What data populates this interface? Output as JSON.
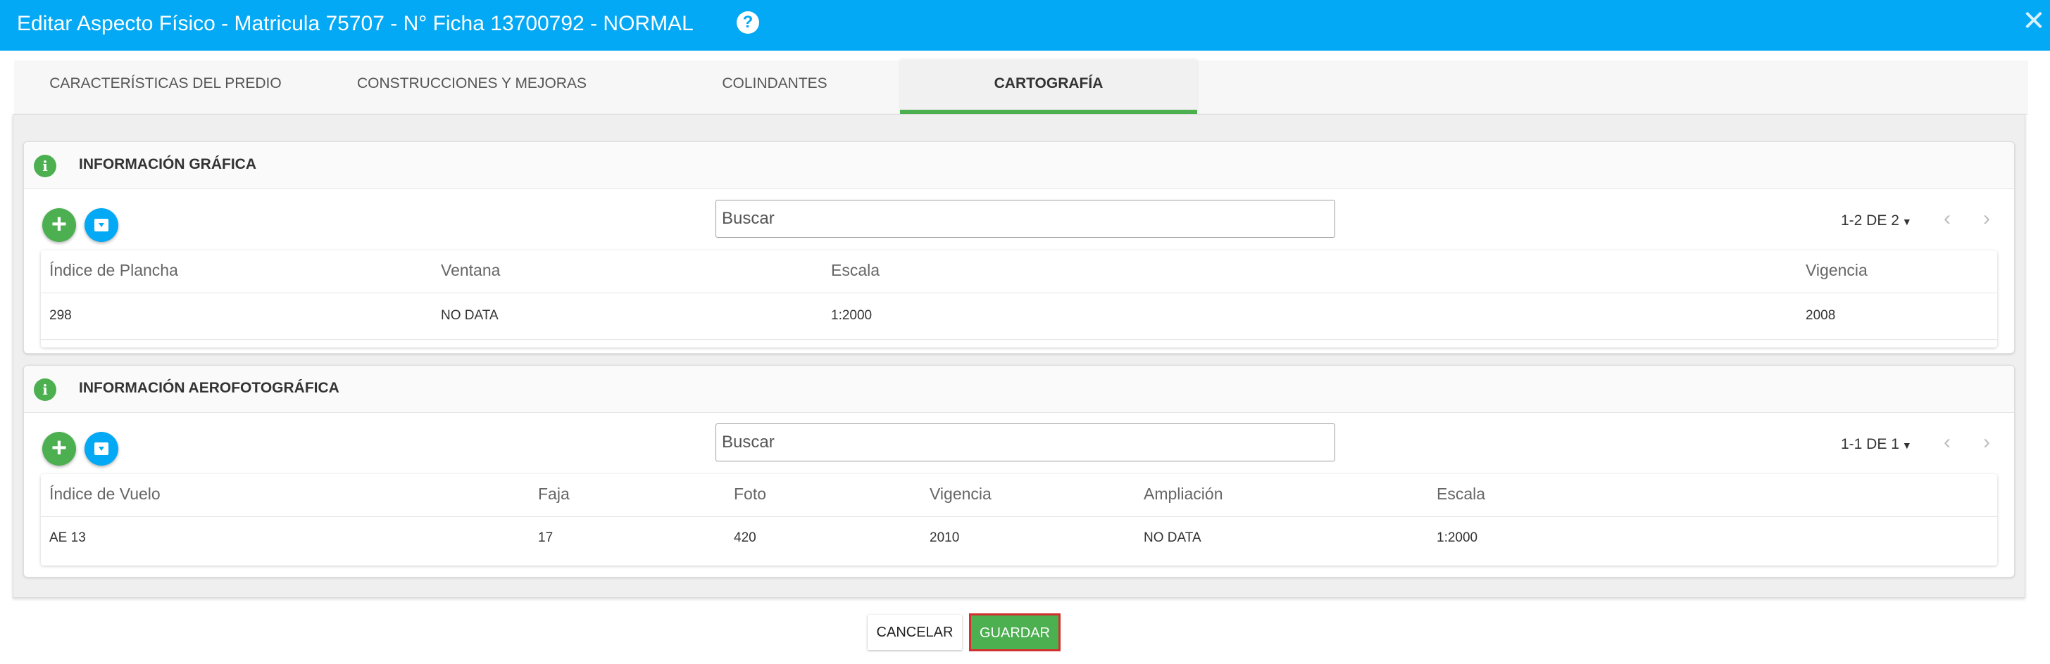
{
  "header": {
    "title": "Editar Aspecto Físico - Matricula 75707 - N° Ficha 13700792 - NORMAL",
    "help_icon": "?",
    "close_icon": "✕"
  },
  "tabs": [
    {
      "label": "CARACTERÍSTICAS DEL PREDIO",
      "active": false
    },
    {
      "label": "CONSTRUCCIONES Y MEJORAS",
      "active": false
    },
    {
      "label": "COLINDANTES",
      "active": false
    },
    {
      "label": "CARTOGRAFÍA",
      "active": true
    }
  ],
  "grafica": {
    "title": "INFORMACIÓN GRÁFICA",
    "add_icon": "+",
    "search_placeholder": "Buscar",
    "pager": "1-2 DE 2",
    "columns": [
      "Índice de Plancha",
      "Ventana",
      "Escala",
      "Vigencia"
    ],
    "rows": [
      [
        "298",
        "NO DATA",
        "1:2000",
        "2008"
      ]
    ]
  },
  "aerofoto": {
    "title": "INFORMACIÓN AEROFOTOGRÁFICA",
    "add_icon": "+",
    "search_placeholder": "Buscar",
    "pager": "1-1 DE 1",
    "columns": [
      "Índice de Vuelo",
      "Faja",
      "Foto",
      "Vigencia",
      "Ampliación",
      "Escala"
    ],
    "rows": [
      [
        "AE 13",
        "17",
        "420",
        "2010",
        "NO DATA",
        "1:2000"
      ]
    ]
  },
  "footer": {
    "cancel_label": "CANCELAR",
    "save_label": "GUARDAR"
  },
  "colors": {
    "header": "#03a9f4",
    "accent_green": "#4caf50",
    "highlight_red": "#d32f2f"
  },
  "icons": {
    "info": "info-icon",
    "add": "add-icon",
    "archive": "archive-icon",
    "prev": "chevron-left-icon",
    "next": "chevron-right-icon",
    "dropdown": "caret-down-icon"
  }
}
